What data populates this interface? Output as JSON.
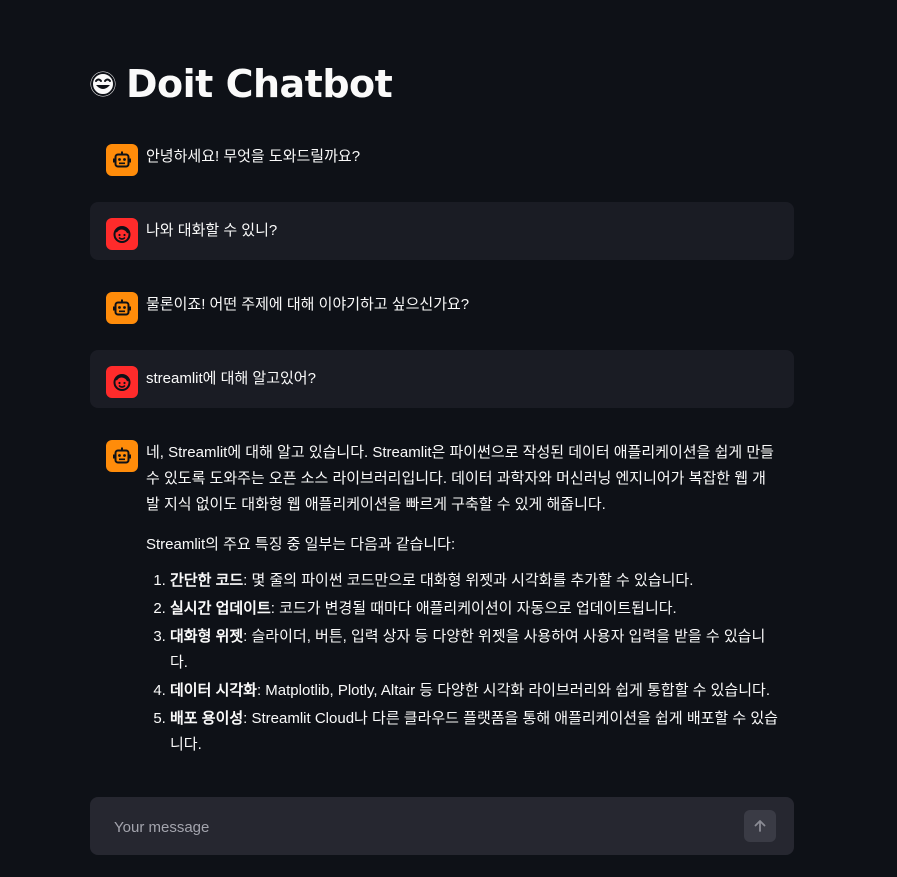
{
  "app": {
    "title": "Doit Chatbot"
  },
  "icons": {
    "title_icon": "smiling-face-icon",
    "assistant_avatar": "robot-face-icon",
    "user_avatar": "person-face-icon",
    "send": "arrow-up-icon"
  },
  "colors": {
    "background": "#0e1117",
    "user_message_bg": "#1a1c24",
    "assistant_avatar": "#ff8c0a",
    "user_avatar": "#ff2b2b",
    "input_bg": "#262730"
  },
  "messages": [
    {
      "role": "assistant",
      "text": "안녕하세요! 무엇을 도와드릴까요?"
    },
    {
      "role": "user",
      "text": "나와 대화할 수 있니?"
    },
    {
      "role": "assistant",
      "text": "물론이죠! 어떤 주제에 대해 이야기하고 싶으신가요?"
    },
    {
      "role": "user",
      "text": "streamlit에 대해 알고있어?"
    },
    {
      "role": "assistant",
      "paragraph1": "네, Streamlit에 대해 알고 있습니다. Streamlit은 파이썬으로 작성된 데이터 애플리케이션을 쉽게 만들 수 있도록 도와주는 오픈 소스 라이브러리입니다. 데이터 과학자와 머신러닝 엔지니어가 복잡한 웹 개발 지식 없이도 대화형 웹 애플리케이션을 빠르게 구축할 수 있게 해줍니다.",
      "paragraph2": "Streamlit의 주요 특징 중 일부는 다음과 같습니다:",
      "features": [
        {
          "name": "간단한 코드",
          "desc": ": 몇 줄의 파이썬 코드만으로 대화형 위젯과 시각화를 추가할 수 있습니다."
        },
        {
          "name": "실시간 업데이트",
          "desc": ": 코드가 변경될 때마다 애플리케이션이 자동으로 업데이트됩니다."
        },
        {
          "name": "대화형 위젯",
          "desc": ": 슬라이더, 버튼, 입력 상자 등 다양한 위젯을 사용하여 사용자 입력을 받을 수 있습니다."
        },
        {
          "name": "데이터 시각화",
          "desc": ": Matplotlib, Plotly, Altair 등 다양한 시각화 라이브러리와 쉽게 통합할 수 있습니다."
        },
        {
          "name": "배포 용이성",
          "desc": ": Streamlit Cloud나 다른 클라우드 플랫폼을 통해 애플리케이션을 쉽게 배포할 수 있습니다."
        }
      ]
    }
  ],
  "chat_input": {
    "placeholder": "Your message",
    "value": ""
  }
}
